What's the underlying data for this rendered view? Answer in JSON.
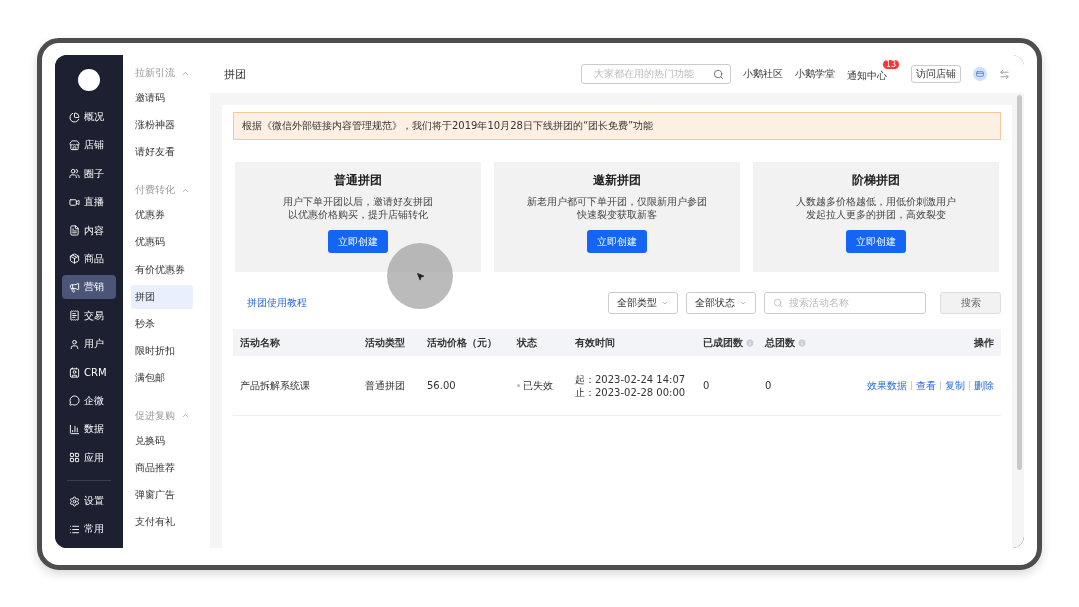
{
  "nav": [
    {
      "label": "概况",
      "selected": false
    },
    {
      "label": "店铺",
      "selected": false
    },
    {
      "label": "圈子",
      "selected": false
    },
    {
      "label": "直播",
      "selected": false
    },
    {
      "label": "内容",
      "selected": false
    },
    {
      "label": "商品",
      "selected": false
    },
    {
      "label": "营销",
      "selected": true
    },
    {
      "label": "交易",
      "selected": false
    },
    {
      "label": "用户",
      "selected": false
    },
    {
      "label": "CRM",
      "selected": false
    },
    {
      "label": "企微",
      "selected": false
    },
    {
      "label": "数据",
      "selected": false
    },
    {
      "label": "应用",
      "selected": false
    }
  ],
  "nav_bottom": [
    "设置",
    "常用"
  ],
  "submenu": [
    {
      "title": "拉新引流",
      "expanded": true,
      "items": [
        {
          "label": "邀请码",
          "selected": false
        },
        {
          "label": "涨粉神器",
          "selected": false
        },
        {
          "label": "请好友看",
          "selected": false
        }
      ]
    },
    {
      "title": "付费转化",
      "expanded": true,
      "items": [
        {
          "label": "优惠券",
          "selected": false
        },
        {
          "label": "优惠码",
          "selected": false
        },
        {
          "label": "有价优惠券",
          "selected": false
        },
        {
          "label": "拼团",
          "selected": true
        },
        {
          "label": "秒杀",
          "selected": false
        },
        {
          "label": "限时折扣",
          "selected": false
        },
        {
          "label": "满包邮",
          "selected": false
        }
      ]
    },
    {
      "title": "促进复购",
      "expanded": true,
      "items": [
        {
          "label": "兑换码",
          "selected": false
        },
        {
          "label": "商品推荐",
          "selected": false
        },
        {
          "label": "弹窗广告",
          "selected": false
        },
        {
          "label": "支付有礼",
          "selected": false
        }
      ]
    }
  ],
  "header": {
    "title": "拼团",
    "search_placeholder": "大家都在用的热门功能",
    "links": [
      "小鹅社区",
      "小鹅学堂"
    ],
    "notice": {
      "label": "通知中心",
      "badge": "13"
    },
    "visit_button": "访问店铺"
  },
  "notice_banner": "根据《微信外部链接内容管理规范》，我们将于2019年10月28日下线拼团的“团长免费”功能",
  "cards": [
    {
      "title": "普通拼团",
      "desc": [
        "用户下单开团以后，邀请好友拼团",
        "以优惠价格购买，提升店铺转化"
      ],
      "button": "立即创建"
    },
    {
      "title": "邀新拼团",
      "desc": [
        "新老用户都可下单开团，仅限新用户参团",
        "快速裂变获取新客"
      ],
      "button": "立即创建"
    },
    {
      "title": "阶梯拼团",
      "desc": [
        "人数越多价格越低，用低价刺激用户",
        "发起拉人更多的拼团，高效裂变"
      ],
      "button": "立即创建"
    }
  ],
  "toolbar": {
    "tutorial_link": "拼团使用教程",
    "filters": [
      "全部类型",
      "全部状态"
    ],
    "search_placeholder": "搜索活动名称",
    "search_button": "搜索"
  },
  "table": {
    "columns": [
      {
        "label": "活动名称",
        "info": false
      },
      {
        "label": "活动类型",
        "info": false
      },
      {
        "label": "活动价格（元）",
        "info": false
      },
      {
        "label": "状态",
        "info": false
      },
      {
        "label": "有效时间",
        "info": false
      },
      {
        "label": "已成团数",
        "info": true
      },
      {
        "label": "总团数",
        "info": true
      },
      {
        "label": "操作",
        "info": false
      }
    ],
    "rows": [
      {
        "name": "产品拆解系统课",
        "type": "普通拼团",
        "price": "56.00",
        "status": "已失效",
        "active": false,
        "time": [
          "起：2023-02-24 14:07",
          "止：2023-02-28 00:00"
        ],
        "done": "0",
        "total": "0",
        "actions": [
          "效果数据",
          "查看",
          "复制",
          "删除"
        ]
      }
    ]
  }
}
